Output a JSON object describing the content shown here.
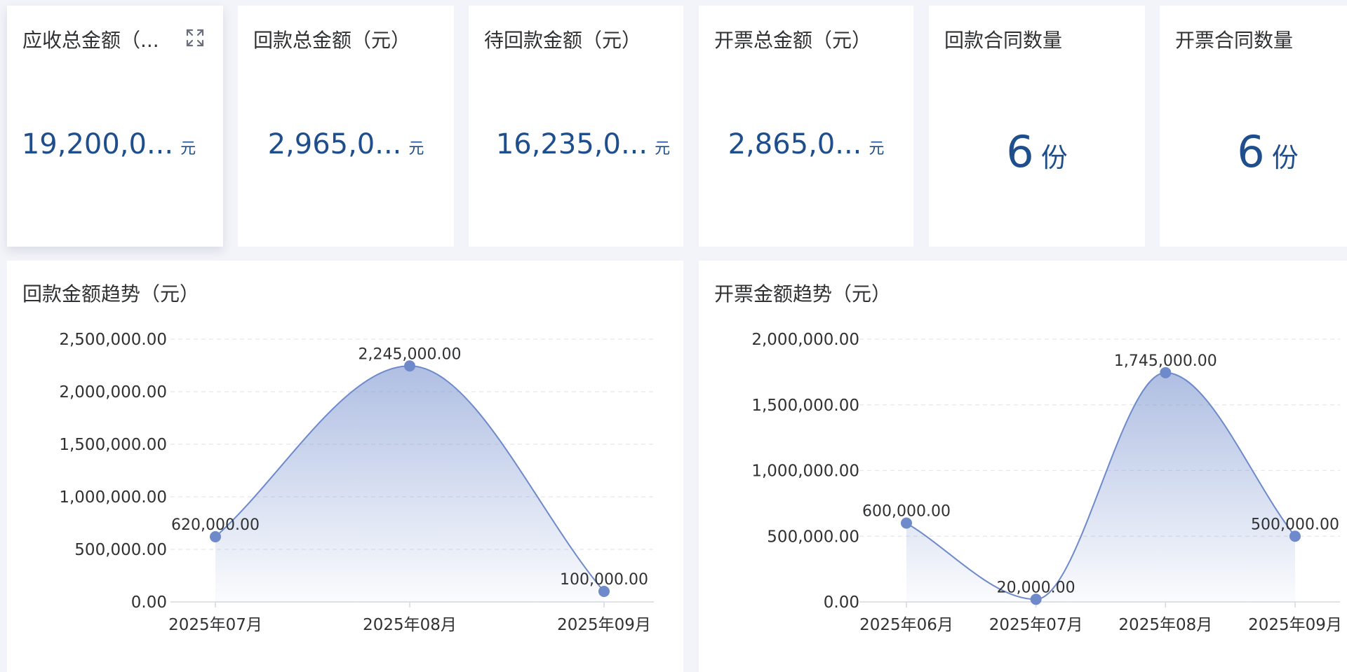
{
  "kpis": [
    {
      "title": "应收总金额（...",
      "value": "19,200,0...",
      "unit": "元"
    },
    {
      "title": "回款总金额（元）",
      "value": "2,965,0...",
      "unit": "元"
    },
    {
      "title": "待回款金额（元）",
      "value": "16,235,0...",
      "unit": "元"
    },
    {
      "title": "开票总金额（元）",
      "value": "2,865,0...",
      "unit": "元"
    },
    {
      "title": "回款合同数量",
      "value": "6",
      "unit": "份"
    },
    {
      "title": "开票合同数量",
      "value": "6",
      "unit": "份"
    }
  ],
  "colors": {
    "accent": "#6e8acb",
    "value_text": "#1f4e8c"
  },
  "icons": {
    "expand": "expand-icon"
  },
  "chart_data": [
    {
      "type": "area",
      "title": "回款金额趋势（元）",
      "categories": [
        "2025年07月",
        "2025年08月",
        "2025年09月"
      ],
      "values": [
        620000,
        2245000,
        100000
      ],
      "data_labels": [
        "620,000.00",
        "2,245,000.00",
        "100,000.00"
      ],
      "y_ticks": [
        "0.00",
        "500,000.00",
        "1,000,000.00",
        "1,500,000.00",
        "2,000,000.00",
        "2,500,000.00"
      ],
      "ylim": [
        0,
        2500000
      ],
      "grid": true
    },
    {
      "type": "area",
      "title": "开票金额趋势（元）",
      "categories": [
        "2025年06月",
        "2025年07月",
        "2025年08月",
        "2025年09月"
      ],
      "values": [
        600000,
        20000,
        1745000,
        500000
      ],
      "data_labels": [
        "600,000.00",
        "20,000.00",
        "1,745,000.00",
        "500,000.00"
      ],
      "y_ticks": [
        "0.00",
        "500,000.00",
        "1,000,000.00",
        "1,500,000.00",
        "2,000,000.00"
      ],
      "ylim": [
        0,
        2000000
      ],
      "grid": true
    }
  ]
}
